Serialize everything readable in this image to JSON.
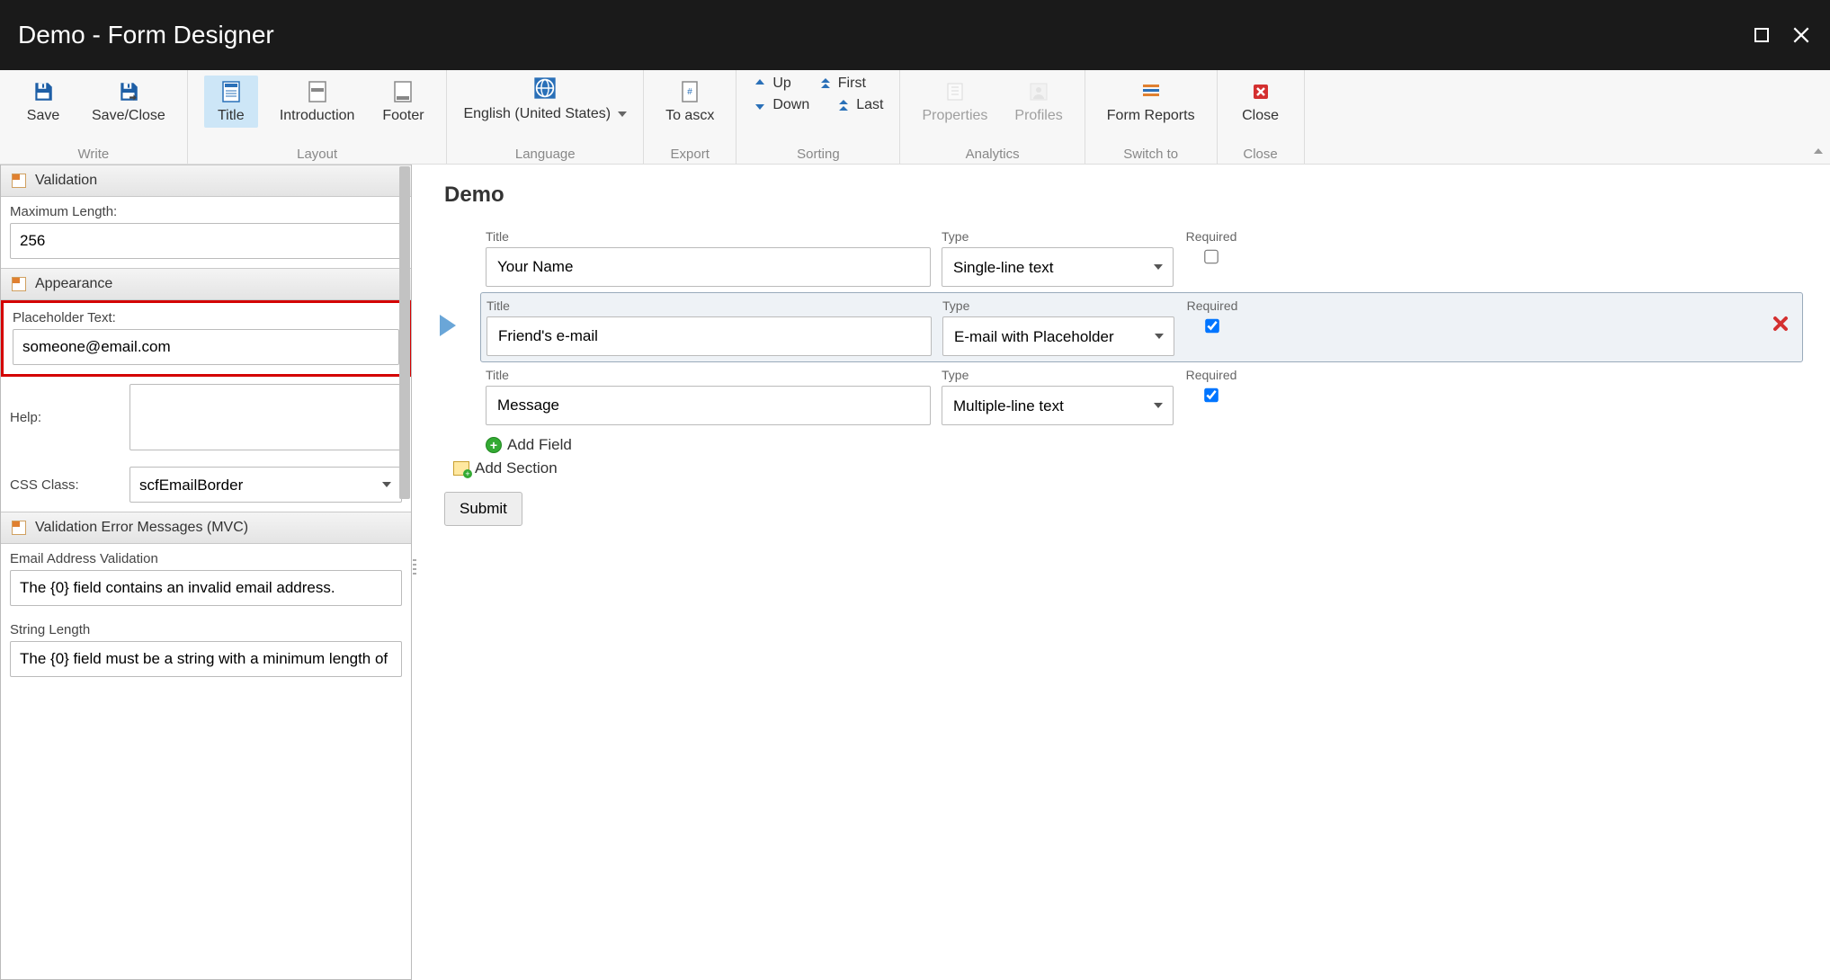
{
  "titlebar": {
    "title": "Demo - Form Designer"
  },
  "ribbon": {
    "groups": {
      "write": {
        "label": "Write",
        "save": "Save",
        "save_close": "Save/Close"
      },
      "layout": {
        "label": "Layout",
        "title": "Title",
        "introduction": "Introduction",
        "footer": "Footer"
      },
      "language": {
        "label": "Language",
        "current": "English (United States)"
      },
      "export": {
        "label": "Export",
        "to_ascx": "To ascx"
      },
      "sorting": {
        "label": "Sorting",
        "up": "Up",
        "down": "Down",
        "first": "First",
        "last": "Last"
      },
      "analytics": {
        "label": "Analytics",
        "properties": "Properties",
        "profiles": "Profiles"
      },
      "switch_to": {
        "label": "Switch to",
        "form_reports": "Form Reports"
      },
      "close": {
        "label": "Close",
        "close": "Close"
      }
    }
  },
  "sidebar": {
    "validation": {
      "header": "Validation",
      "max_length_label": "Maximum Length:",
      "max_length_value": "256"
    },
    "appearance": {
      "header": "Appearance",
      "placeholder_label": "Placeholder Text:",
      "placeholder_value": "someone@email.com",
      "help_label": "Help:",
      "help_value": "",
      "css_class_label": "CSS Class:",
      "css_class_value": "scfEmailBorder"
    },
    "errors": {
      "header": "Validation Error Messages (MVC)",
      "email_label": "Email Address Validation",
      "email_value": "The {0} field contains an invalid email address.",
      "strlen_label": "String Length",
      "strlen_value": "The {0} field must be a string with a minimum length of"
    }
  },
  "canvas": {
    "title": "Demo",
    "labels": {
      "title": "Title",
      "type": "Type",
      "required": "Required"
    },
    "rows": [
      {
        "title": "Your Name",
        "type": "Single-line text",
        "required": false,
        "selected": false
      },
      {
        "title": "Friend's e-mail",
        "type": "E-mail with Placeholder",
        "required": true,
        "selected": true
      },
      {
        "title": "Message",
        "type": "Multiple-line text",
        "required": true,
        "selected": false
      }
    ],
    "add_field": "Add Field",
    "add_section": "Add Section",
    "submit": "Submit"
  }
}
